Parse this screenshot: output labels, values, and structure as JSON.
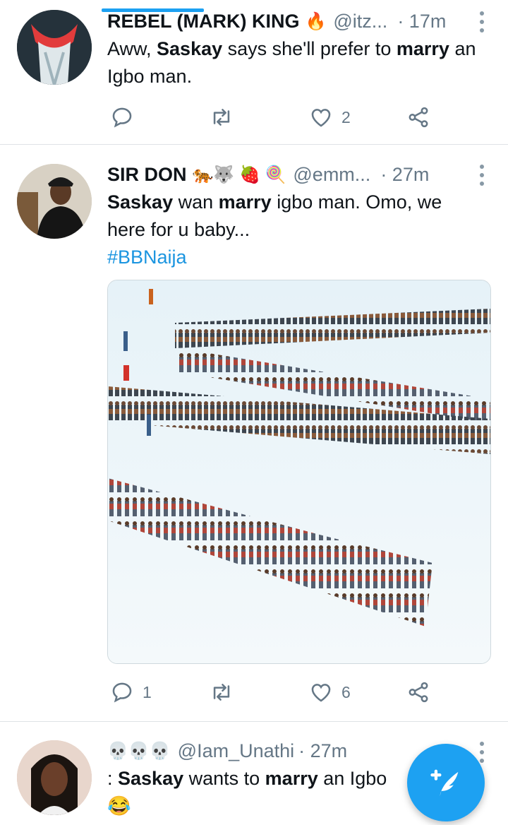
{
  "tweets": [
    {
      "display_name": "REBEL (MARK) KING",
      "name_emoji": "🔥",
      "handle": "@itz...",
      "time": "· 17m",
      "text": {
        "p1": "Aww, ",
        "b1": "Saskay",
        "p2": " says she'll prefer to ",
        "b2": "marry",
        "p3": " an Igbo man."
      },
      "reply_count": "",
      "retweet_count": "",
      "like_count": "2"
    },
    {
      "display_name": "SIR DON",
      "name_emoji": "🐅🐺 🍓 🍭",
      "handle": "@emm...",
      "time": "· 27m",
      "text": {
        "b1": "Saskay",
        "p1": " wan ",
        "b2": "marry",
        "p2": " igbo man. Omo, we here for u baby..."
      },
      "hashtag": "#BBNaija",
      "reply_count": "1",
      "retweet_count": "",
      "like_count": "6"
    },
    {
      "display_name": "",
      "name_emoji": "💀💀💀",
      "handle": "@Iam_Unathi",
      "time": "· 27m",
      "text": {
        "p1": ": ",
        "b1": "Saskay",
        "p2": " wants to ",
        "b2": "marry",
        "p3": " an Igbo"
      },
      "line2_emoji": "😂"
    }
  ],
  "colors": {
    "accent": "#1da1f2",
    "secondary_text": "#657786",
    "divider": "#dfe3e6"
  },
  "icons": [
    "reply-icon",
    "retweet-icon",
    "like-icon",
    "share-icon",
    "more-icon",
    "compose-icon"
  ]
}
